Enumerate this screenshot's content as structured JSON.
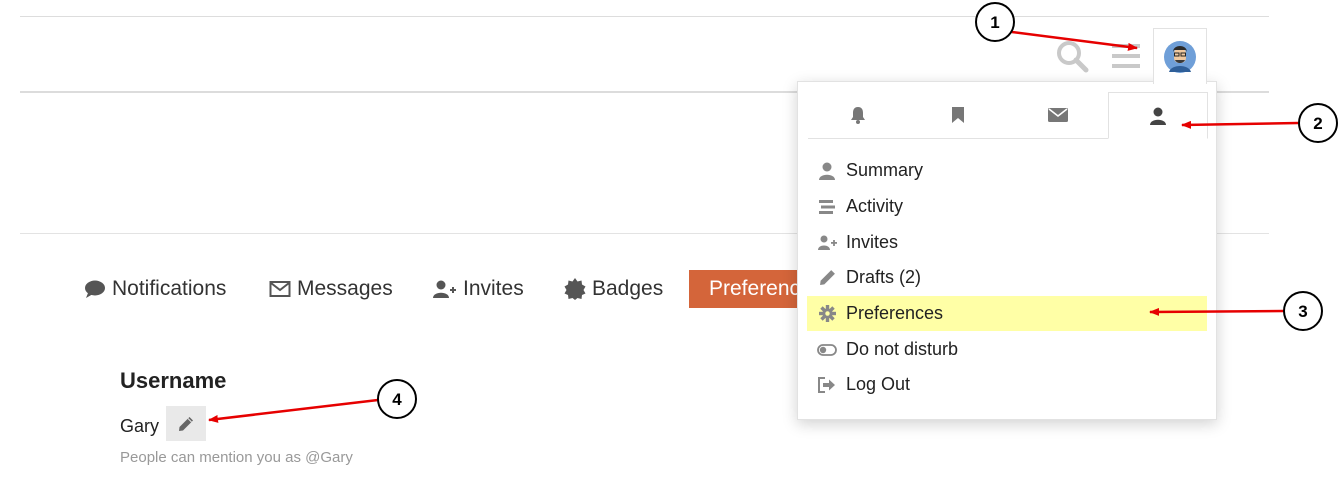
{
  "header": {
    "search_icon": "search-icon",
    "menu_icon": "hamburger-icon",
    "avatar_icon": "user-avatar"
  },
  "nav_tabs": [
    {
      "label": "Notifications",
      "icon": "comment-icon"
    },
    {
      "label": "Messages",
      "icon": "envelope-icon"
    },
    {
      "label": "Invites",
      "icon": "user-plus-icon"
    },
    {
      "label": "Badges",
      "icon": "certificate-icon"
    },
    {
      "label": "Preferences",
      "icon": "gear-icon",
      "active": true
    }
  ],
  "user_menu": {
    "tabs": [
      {
        "icon": "bell-icon"
      },
      {
        "icon": "bookmark-icon"
      },
      {
        "icon": "envelope-icon"
      },
      {
        "icon": "user-icon",
        "active": true
      }
    ],
    "items": [
      {
        "label": "Summary",
        "icon": "user-icon"
      },
      {
        "label": "Activity",
        "icon": "stream-icon"
      },
      {
        "label": "Invites",
        "icon": "user-plus-icon"
      },
      {
        "label": "Drafts (2)",
        "icon": "pencil-icon"
      },
      {
        "label": "Preferences",
        "icon": "gear-icon",
        "highlighted": true
      },
      {
        "label": "Do not disturb",
        "icon": "toggle-off-icon"
      },
      {
        "label": "Log Out",
        "icon": "sign-out-icon"
      }
    ]
  },
  "profile": {
    "username_heading": "Username",
    "username": "Gary",
    "mention_hint": "People can mention you as @Gary"
  },
  "annotations": {
    "callouts": [
      "1",
      "2",
      "3",
      "4"
    ],
    "arrow_color": "#e60000"
  },
  "colors": {
    "accent": "#d4653a",
    "highlight": "#ffffa6"
  }
}
